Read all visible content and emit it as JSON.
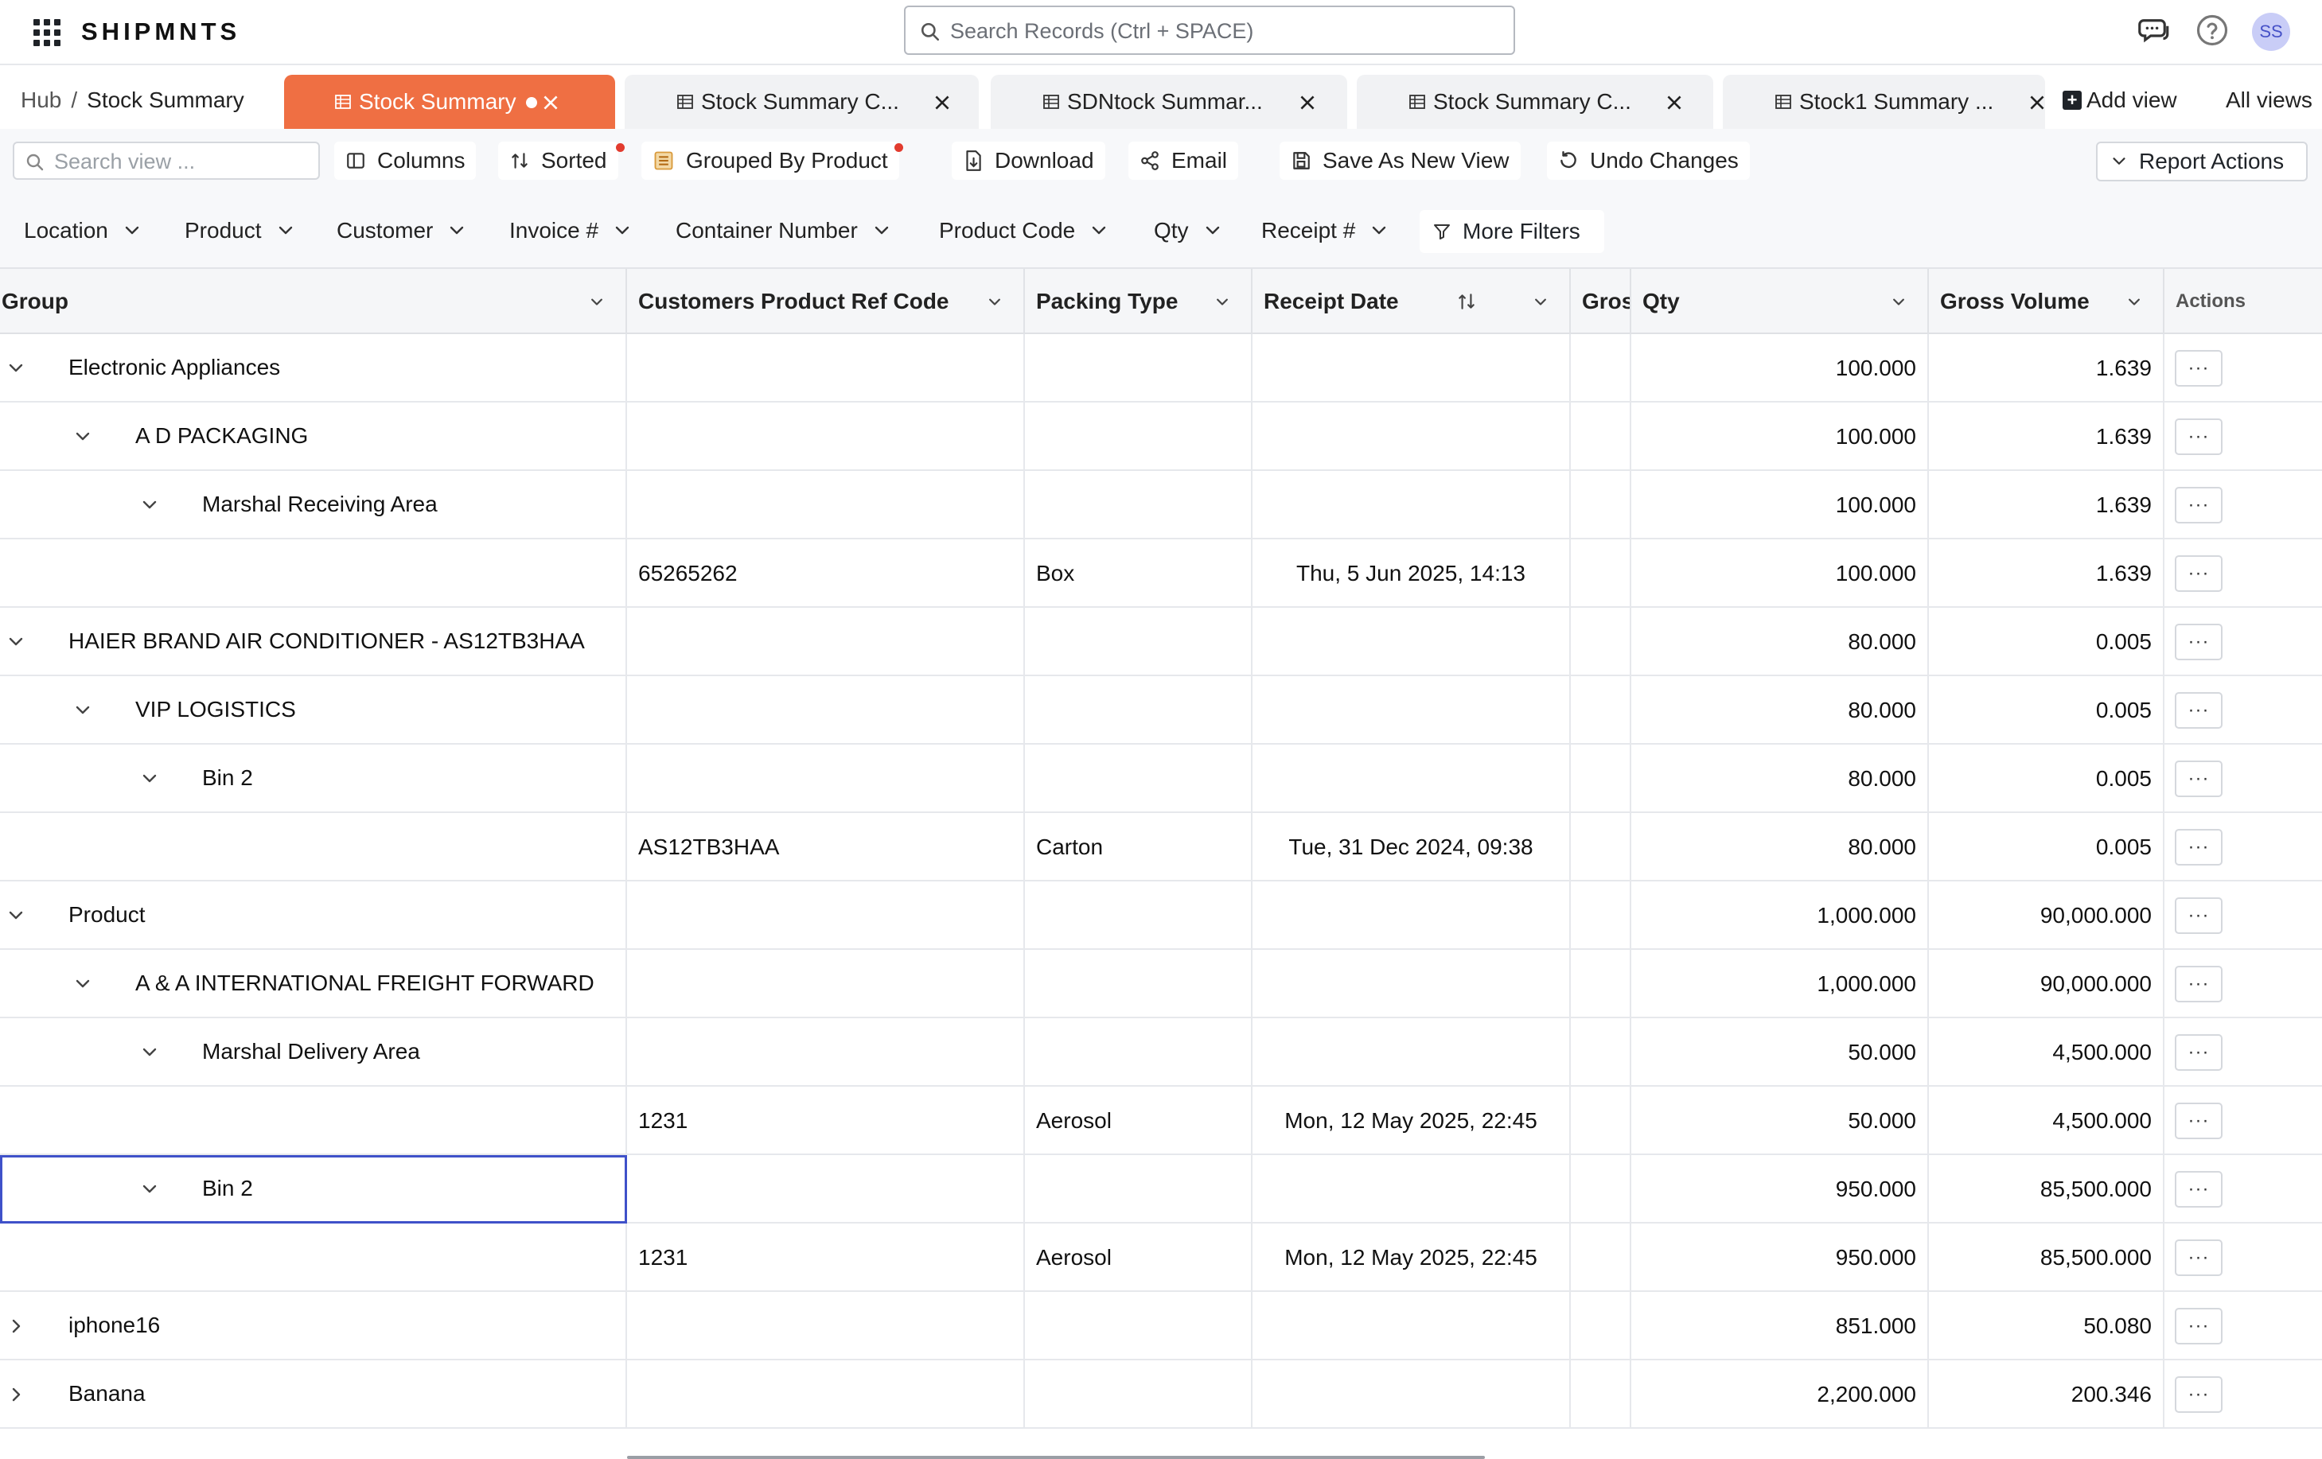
{
  "app": {
    "brand": "SHIPMNTS",
    "search_placeholder": "Search Records (Ctrl + SPACE)",
    "avatar_initials": "SS",
    "accent": "#ef6f43"
  },
  "breadcrumb": {
    "hub": "Hub",
    "current": "Stock Summary"
  },
  "tabs": [
    {
      "label": "Stock Summary",
      "active": true
    },
    {
      "label": "Stock Summary C..."
    },
    {
      "label": "SDNtock Summar..."
    },
    {
      "label": "Stock Summary C..."
    },
    {
      "label": "Stock1 Summary ..."
    }
  ],
  "tab_actions": {
    "add_view": "Add view",
    "all_views": "All views"
  },
  "toolbar": {
    "search_placeholder": "Search view ...",
    "columns": "Columns",
    "sorted": "Sorted",
    "grouped": "Grouped By Product",
    "download": "Download",
    "email": "Email",
    "save_new_view": "Save As New View",
    "undo": "Undo Changes",
    "report_actions": "Report Actions"
  },
  "filters": [
    "Location",
    "Product",
    "Customer",
    "Invoice #",
    "Container Number",
    "Product Code",
    "Qty",
    "Receipt #"
  ],
  "more_filters": "More Filters",
  "columns": {
    "group": "Group",
    "ref_code": "Customers Product Ref Code",
    "packing": "Packing Type",
    "receipt_date": "Receipt Date",
    "gross": "Gros",
    "qty": "Qty",
    "gross_volume": "Gross Volume",
    "actions": "Actions"
  },
  "action_button": "···",
  "rows": [
    {
      "level": 0,
      "expanded": true,
      "label": "Electronic Appliances",
      "ref": "",
      "packing": "",
      "date": "",
      "qty": "100.000",
      "vol": "1.639"
    },
    {
      "level": 1,
      "expanded": true,
      "label": "A D PACKAGING",
      "ref": "",
      "packing": "",
      "date": "",
      "qty": "100.000",
      "vol": "1.639"
    },
    {
      "level": 2,
      "expanded": true,
      "label": "Marshal Receiving Area",
      "ref": "",
      "packing": "",
      "date": "",
      "qty": "100.000",
      "vol": "1.639"
    },
    {
      "level": 3,
      "label": "",
      "ref": "65265262",
      "packing": "Box",
      "date": "Thu, 5 Jun 2025, 14:13",
      "qty": "100.000",
      "vol": "1.639"
    },
    {
      "level": 0,
      "expanded": true,
      "label": "HAIER BRAND AIR CONDITIONER - AS12TB3HAA",
      "ref": "",
      "packing": "",
      "date": "",
      "qty": "80.000",
      "vol": "0.005"
    },
    {
      "level": 1,
      "expanded": true,
      "label": "VIP LOGISTICS",
      "ref": "",
      "packing": "",
      "date": "",
      "qty": "80.000",
      "vol": "0.005"
    },
    {
      "level": 2,
      "expanded": true,
      "label": "Bin 2",
      "ref": "",
      "packing": "",
      "date": "",
      "qty": "80.000",
      "vol": "0.005"
    },
    {
      "level": 3,
      "label": "",
      "ref": "AS12TB3HAA",
      "packing": "Carton",
      "date": "Tue, 31 Dec 2024, 09:38",
      "qty": "80.000",
      "vol": "0.005"
    },
    {
      "level": 0,
      "expanded": true,
      "label": "Product",
      "ref": "",
      "packing": "",
      "date": "",
      "qty": "1,000.000",
      "vol": "90,000.000"
    },
    {
      "level": 1,
      "expanded": true,
      "label": "A & A INTERNATIONAL FREIGHT FORWARD",
      "ref": "",
      "packing": "",
      "date": "",
      "qty": "1,000.000",
      "vol": "90,000.000"
    },
    {
      "level": 2,
      "expanded": true,
      "label": "Marshal Delivery Area",
      "ref": "",
      "packing": "",
      "date": "",
      "qty": "50.000",
      "vol": "4,500.000"
    },
    {
      "level": 3,
      "label": "",
      "ref": "1231",
      "packing": "Aerosol",
      "date": "Mon, 12 May 2025, 22:45",
      "qty": "50.000",
      "vol": "4,500.000"
    },
    {
      "level": 2,
      "expanded": true,
      "label": "Bin 2",
      "ref": "",
      "packing": "",
      "date": "",
      "qty": "950.000",
      "vol": "85,500.000",
      "selected": true
    },
    {
      "level": 3,
      "label": "",
      "ref": "1231",
      "packing": "Aerosol",
      "date": "Mon, 12 May 2025, 22:45",
      "qty": "950.000",
      "vol": "85,500.000"
    },
    {
      "level": 0,
      "expanded": false,
      "label": "iphone16",
      "ref": "",
      "packing": "",
      "date": "",
      "qty": "851.000",
      "vol": "50.080"
    },
    {
      "level": 0,
      "expanded": false,
      "label": "Banana",
      "ref": "",
      "packing": "",
      "date": "",
      "qty": "2,200.000",
      "vol": "200.346"
    }
  ]
}
